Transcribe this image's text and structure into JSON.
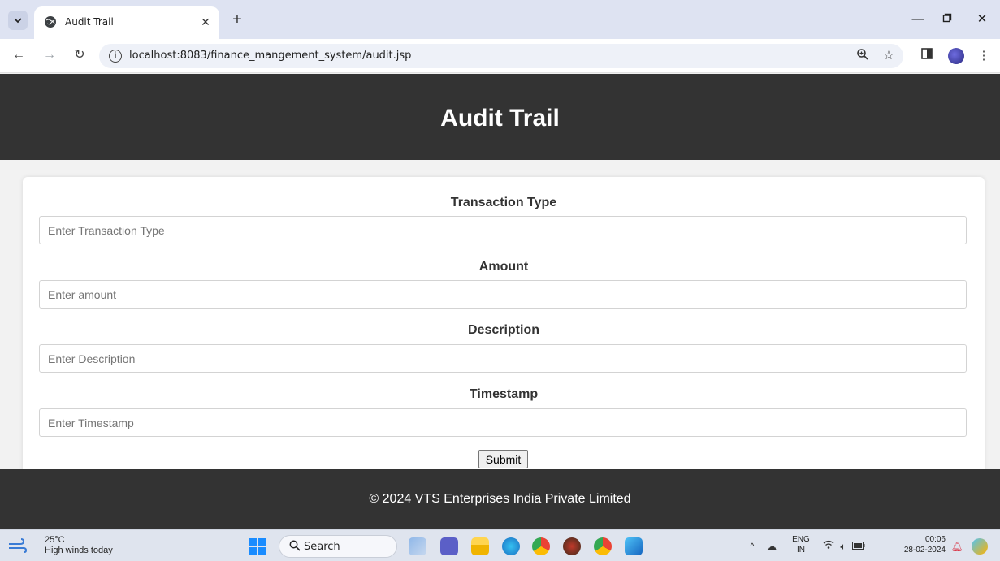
{
  "browser": {
    "tab_title": "Audit Trail",
    "new_tab_symbol": "+",
    "url": "localhost:8083/finance_mangement_system/audit.jsp"
  },
  "page": {
    "header_title": "Audit Trail",
    "fields": [
      {
        "label": "Transaction Type",
        "placeholder": "Enter Transaction Type"
      },
      {
        "label": "Amount",
        "placeholder": "Enter amount"
      },
      {
        "label": "Description",
        "placeholder": "Enter Description"
      },
      {
        "label": "Timestamp",
        "placeholder": "Enter Timestamp"
      }
    ],
    "submit_label": "Submit",
    "footer_text": "© 2024 VTS Enterprises India Private Limited"
  },
  "taskbar": {
    "weather_temp": "25°C",
    "weather_desc": "High winds today",
    "search_label": "Search",
    "lang_top": "ENG",
    "lang_bottom": "IN",
    "time": "00:06",
    "date": "28-02-2024"
  },
  "colors": {
    "header_bg": "#333333",
    "footer_bg": "#333333",
    "tabbar_bg": "#dee3f2"
  }
}
